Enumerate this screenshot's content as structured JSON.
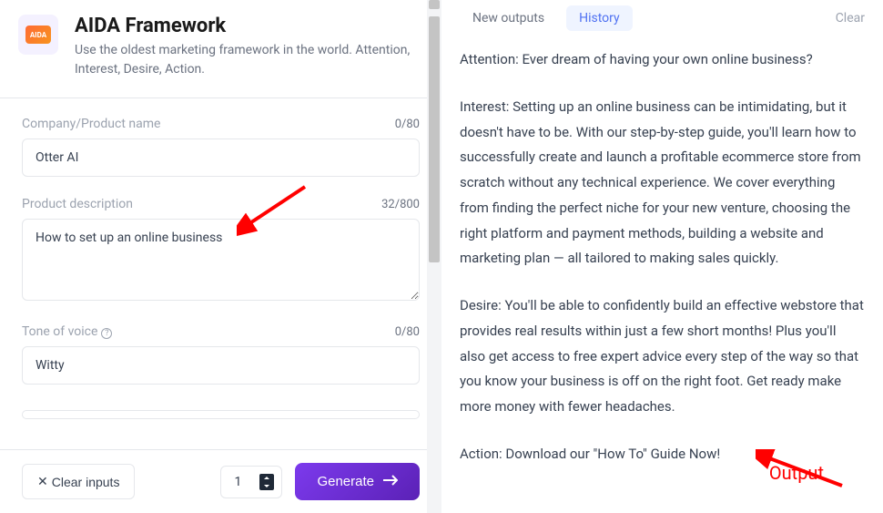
{
  "header": {
    "title": "AIDA Framework",
    "subtitle": "Use the oldest marketing framework in the world. Attention, Interest, Desire, Action.",
    "icon_label": "AIDA"
  },
  "form": {
    "company": {
      "label": "Company/Product name",
      "value": "Otter AI",
      "count": "0/80"
    },
    "description": {
      "label": "Product description",
      "value": "How to set up an online business",
      "count": "32/800"
    },
    "tone": {
      "label": "Tone of voice",
      "value": "Witty",
      "count": "0/80"
    }
  },
  "bottom": {
    "clear_label": "Clear inputs",
    "quantity": "1",
    "generate_label": "Generate"
  },
  "tabs": {
    "new_outputs": "New outputs",
    "history": "History",
    "clear": "Clear"
  },
  "output": {
    "attention": "Attention: Ever dream of having your own online business?",
    "interest": "Interest: Setting up an online business can be intimidating, but it doesn't have to be. With our step-by-step guide, you'll learn how to successfully create and launch a profitable ecommerce store from scratch without any technical experience. We cover everything from finding the perfect niche for your new venture, choosing the right platform and payment methods, building a website and marketing plan — all tailored to making sales quickly.",
    "desire": "Desire: You'll be able to confidently build an effective webstore that provides real results within just a few short months! Plus you'll also get access to free expert advice every step of the way so that you know your business is off on the right foot. Get ready make more money with fewer headaches.",
    "action": "Action: Download our \"How To\" Guide Now!"
  },
  "annotation_label": "Output"
}
